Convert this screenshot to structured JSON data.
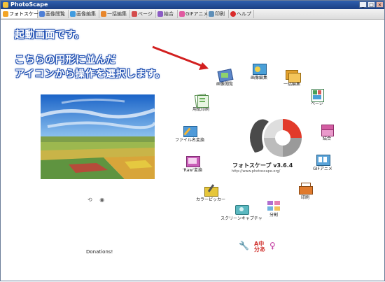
{
  "window": {
    "title": "PhotoScape",
    "btn_min": "_",
    "btn_max": "□",
    "btn_close": "×"
  },
  "tabs": [
    {
      "label": "フォトスケープ",
      "color": "#f2a425"
    },
    {
      "label": "画像閲覧",
      "color": "#4e7fd6"
    },
    {
      "label": "画像編集",
      "color": "#3f9be0"
    },
    {
      "label": "一括編集",
      "color": "#e8862b"
    },
    {
      "label": "ページ",
      "color": "#d44c4c"
    },
    {
      "label": "結合",
      "color": "#8b5bc4"
    },
    {
      "label": "GIFアニメ",
      "color": "#e05aa0"
    },
    {
      "label": "印刷",
      "color": "#5f8fb8"
    },
    {
      "label": "ヘルプ",
      "color": "#d92b2b"
    }
  ],
  "annotation": {
    "line1": "起動画面です。",
    "line2": "こちらの円形に並んだ",
    "line3": "アイコンから操作を選択します。"
  },
  "menu": [
    {
      "label": "画像閲覧",
      "color": "#5b86c9"
    },
    {
      "label": "画像編集",
      "color": "#4aa0d8"
    },
    {
      "label": "一括編集",
      "color": "#e3a12d"
    },
    {
      "label": "ページ",
      "color": "#47a05a"
    },
    {
      "label": "結合",
      "color": "#d35da2"
    },
    {
      "label": "GIFアニメ",
      "color": "#5aa3d8"
    },
    {
      "label": "印刷",
      "color": "#e07a2d"
    },
    {
      "label": "分割",
      "color": "#b06fd0"
    },
    {
      "label": "スクリーンキャプチャ",
      "color": "#5bb8c0"
    },
    {
      "label": "カラーピッカー",
      "color": "#e6c63a"
    },
    {
      "label": "'Raw'変換",
      "color": "#c95db8"
    },
    {
      "label": "ファイル名変換",
      "color": "#4f9ad9"
    },
    {
      "label": "用紙印刷",
      "color": "#6bb05c"
    }
  ],
  "center": {
    "name": "フォトスケープ v3.6.4",
    "url": "http://www.photoscape.org/"
  },
  "donate": "Donations!"
}
